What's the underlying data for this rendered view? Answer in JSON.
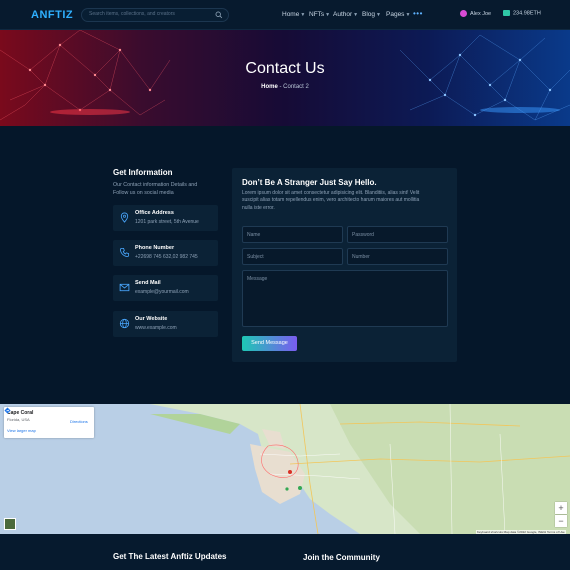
{
  "header": {
    "logo": "ANFTIZ",
    "search_placeholder": "Search items, collections, and creators",
    "nav": [
      {
        "label": "Home"
      },
      {
        "label": "NFTs"
      },
      {
        "label": "Author"
      },
      {
        "label": "Blog"
      },
      {
        "label": "Pages"
      }
    ],
    "more": "•••",
    "user_name": "Alex Joe",
    "wallet_balance": "234.98ETH",
    "accent_color": "#2fb0ff"
  },
  "hero": {
    "title": "Contact Us",
    "breadcrumb_home": "Home",
    "breadcrumb_sep": " - ",
    "breadcrumb_current": "Contact 2"
  },
  "info": {
    "title": "Get Information",
    "description": "Our Contact information Details and Follow us on social media",
    "cards": [
      {
        "icon": "location-pin-icon",
        "title": "Office Address",
        "text": "1201 park street, 5th Avenue"
      },
      {
        "icon": "phone-icon",
        "title": "Phone Number",
        "text": "+22698 745 632,02 982 745"
      },
      {
        "icon": "mail-icon",
        "title": "Send Mail",
        "text": "example@yourmail.com"
      },
      {
        "icon": "globe-icon",
        "title": "Our Website",
        "text": "www.example.com"
      }
    ]
  },
  "form": {
    "title": "Don’t Be A Stranger Just Say Hello.",
    "description": "Lorem ipsum dolor sit amet consectetur adipisicing elit. Blanditiis, alias sint! Velit suscipit alias totam repellendus enim, vero architecto harum maiores aut mollitia nulla iste error.",
    "name_placeholder": "Name",
    "password_placeholder": "Password",
    "subject_placeholder": "Subject",
    "number_placeholder": "Number",
    "message_placeholder": "Message",
    "submit_label": "Send Message"
  },
  "map": {
    "place": "Cape Coral",
    "region": "Florida, USA",
    "larger_map": "View larger map",
    "directions": "Directions",
    "zoom_in": "+",
    "zoom_out": "−",
    "attribution": "Keyboard shortcuts   Map data ©2022 Google, INEGI   Terms of Use"
  },
  "footer": {
    "updates_title": "Get The Latest Anftiz Updates",
    "community_title": "Join the Community"
  }
}
